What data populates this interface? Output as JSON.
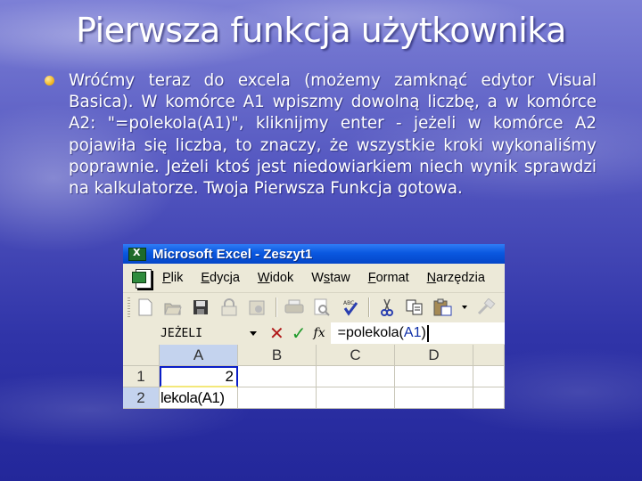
{
  "slide": {
    "title": "Pierwsza funkcja użytkownika",
    "bullet_color": "#f2b823",
    "body": "Wróćmy teraz do excela (możemy zamknąć edytor Visual Basica). W komórce A1 wpiszmy dowolną liczbę, a w komórce A2: \"=polekola(A1)\", kliknijmy enter - jeżeli w komórce A2 pojawiła się liczba, to znaczy, że wszystkie kroki wykonaliśmy poprawnie. Jeżeli ktoś jest niedowiarkiem niech wynik sprawdzi na kalkulatorze. Twoja Pierwsza Funkcja gotowa."
  },
  "excel": {
    "window_title": "Microsoft Excel - Zeszyt1",
    "menu": [
      {
        "accel": "P",
        "rest": "lik"
      },
      {
        "accel": "E",
        "rest": "dycja"
      },
      {
        "accel": "W",
        "rest": "idok"
      },
      {
        "pre": "W",
        "accel": "s",
        "rest": "taw"
      },
      {
        "accel": "F",
        "rest": "ormat"
      },
      {
        "accel": "N",
        "rest": "arzędzia"
      }
    ],
    "toolbar_icons": [
      "new-icon",
      "open-icon",
      "save-icon",
      "permission-icon",
      "email-icon",
      "print-icon",
      "print-preview-icon",
      "spelling-icon",
      "cut-icon",
      "copy-icon",
      "paste-icon",
      "format-painter-icon"
    ],
    "formula_bar": {
      "name_box": "JEŻELI",
      "cancel_symbol": "✕",
      "enter_symbol": "✓",
      "fx_label": "fx",
      "formula_prefix": "=polekola(",
      "formula_ref": "A1",
      "formula_suffix": ")"
    },
    "grid": {
      "columns": [
        "A",
        "B",
        "C",
        "D"
      ],
      "rows": [
        {
          "header": "1",
          "cells": [
            "2",
            "",
            "",
            ""
          ]
        },
        {
          "header": "2",
          "cells": [
            "lekola(A1)",
            "",
            "",
            ""
          ]
        }
      ],
      "active_cell": "A1"
    }
  }
}
